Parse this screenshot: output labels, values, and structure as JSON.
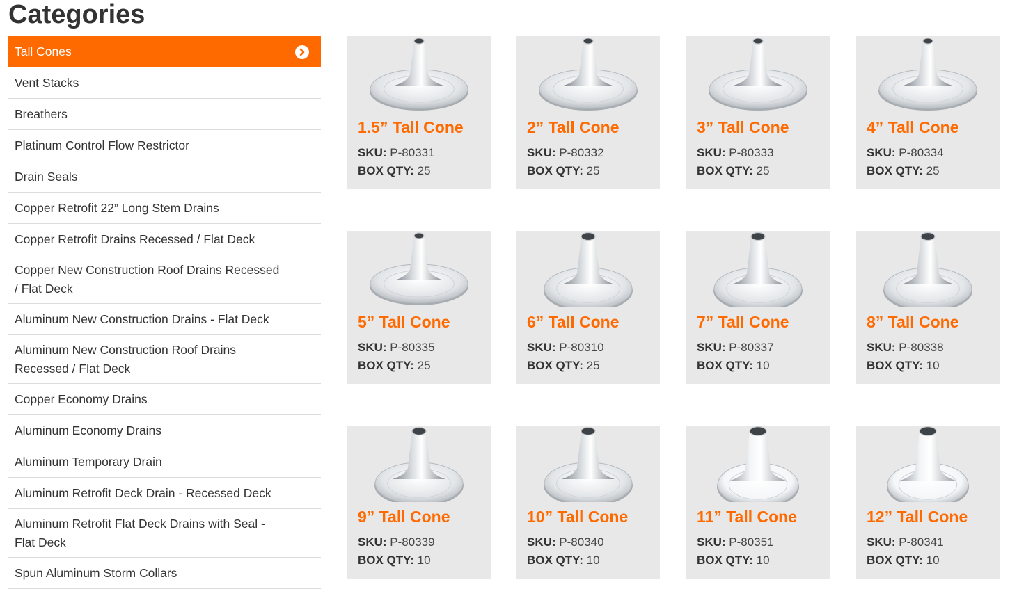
{
  "sidebar": {
    "title": "Categories",
    "items": [
      {
        "label": "Tall Cones",
        "active": true
      },
      {
        "label": "Vent Stacks"
      },
      {
        "label": "Breathers"
      },
      {
        "label": "Platinum Control Flow Restrictor"
      },
      {
        "label": "Drain Seals"
      },
      {
        "label": "Copper Retrofit 22” Long Stem Drains"
      },
      {
        "label": "Copper Retrofit Drains Recessed / Flat Deck"
      },
      {
        "label": "Copper New Construction Roof Drains Recessed / Flat Deck",
        "two_line": true
      },
      {
        "label": "Aluminum New Construction Drains - Flat Deck"
      },
      {
        "label": "Aluminum New Construction Roof Drains Recessed / Flat Deck",
        "two_line": true
      },
      {
        "label": "Copper Economy Drains"
      },
      {
        "label": "Aluminum Economy Drains"
      },
      {
        "label": "Aluminum Temporary Drain"
      },
      {
        "label": "Aluminum Retrofit Deck Drain - Recessed Deck"
      },
      {
        "label": "Aluminum Retrofit Flat Deck Drains with Seal - Flat Deck",
        "two_line": true
      },
      {
        "label": "Spun Aluminum Storm Collars"
      }
    ]
  },
  "labels": {
    "sku": "SKU:",
    "box_qty": "BOX QTY:"
  },
  "products": [
    {
      "name": "1.5” Tall Cone",
      "sku": "P-80331",
      "box_qty": "25",
      "shape": "wide"
    },
    {
      "name": "2” Tall Cone",
      "sku": "P-80332",
      "box_qty": "25",
      "shape": "wide"
    },
    {
      "name": "3” Tall Cone",
      "sku": "P-80333",
      "box_qty": "25",
      "shape": "wide"
    },
    {
      "name": "4” Tall Cone",
      "sku": "P-80334",
      "box_qty": "25",
      "shape": "wide"
    },
    {
      "name": "5” Tall Cone",
      "sku": "P-80335",
      "box_qty": "25",
      "shape": "wide"
    },
    {
      "name": "6” Tall Cone",
      "sku": "P-80310",
      "box_qty": "25",
      "shape": "medium"
    },
    {
      "name": "7” Tall Cone",
      "sku": "P-80337",
      "box_qty": "10",
      "shape": "medium"
    },
    {
      "name": "8” Tall Cone",
      "sku": "P-80338",
      "box_qty": "10",
      "shape": "medium"
    },
    {
      "name": "9” Tall Cone",
      "sku": "P-80339",
      "box_qty": "10",
      "shape": "medium"
    },
    {
      "name": "10” Tall Cone",
      "sku": "P-80340",
      "box_qty": "10",
      "shape": "medium"
    },
    {
      "name": "11” Tall Cone",
      "sku": "P-80351",
      "box_qty": "10",
      "shape": "bright"
    },
    {
      "name": "12” Tall Cone",
      "sku": "P-80341",
      "box_qty": "10",
      "shape": "bright"
    }
  ],
  "colors": {
    "accent": "#ff6a00",
    "card_bg": "#e8e8e8"
  },
  "icons": {
    "active_item": "chevron-right-circle-icon",
    "product_image": "tall-cone-icon"
  }
}
